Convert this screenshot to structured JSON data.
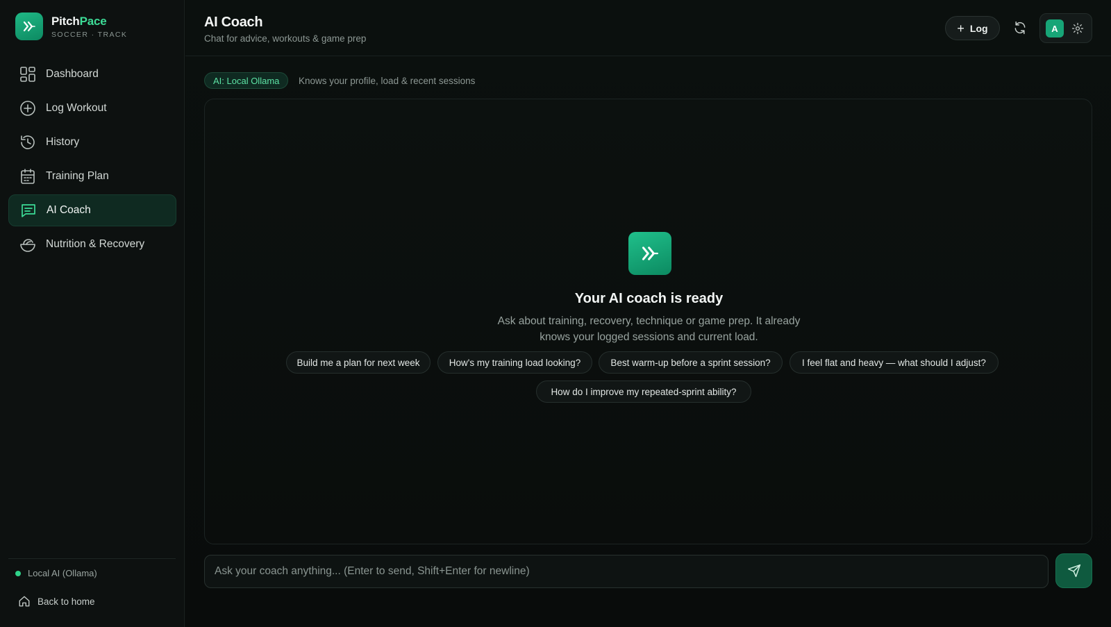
{
  "brand": {
    "name_part1": "Pitch",
    "name_part2": "Pace",
    "subtitle": "SOCCER · TRACK"
  },
  "sidebar": {
    "items": [
      {
        "label": "Dashboard",
        "icon": "dashboard-grid-icon"
      },
      {
        "label": "Log Workout",
        "icon": "plus-circle-icon"
      },
      {
        "label": "History",
        "icon": "history-clock-icon"
      },
      {
        "label": "Training Plan",
        "icon": "calendar-icon"
      },
      {
        "label": "AI Coach",
        "icon": "chat-icon",
        "active": true
      },
      {
        "label": "Nutrition & Recovery",
        "icon": "salad-bowl-icon"
      }
    ],
    "status_label": "Local AI (Ollama)",
    "back_label": "Back to home"
  },
  "header": {
    "title": "AI Coach",
    "subtitle": "Chat for advice, workouts & game prep",
    "log_label": "Log",
    "avatar_letter": "A"
  },
  "ai": {
    "badge": "AI: Local Ollama",
    "description": "Knows your profile, load & recent sessions"
  },
  "chat": {
    "ready_title": "Your AI coach is ready",
    "ready_desc": "Ask about training, recovery, technique or game prep. It already knows your logged sessions and current load.",
    "suggestions": [
      "Build me a plan for next week",
      "How's my training load looking?",
      "Best warm-up before a sprint session?",
      "I feel flat and heavy — what should I adjust?",
      "How do I improve my repeated-sprint ability?"
    ]
  },
  "composer": {
    "placeholder": "Ask your coach anything...  (Enter to send, Shift+Enter for newline)"
  },
  "colors": {
    "accent": "#3ddc97",
    "brand_green": "#17a577",
    "background": "#0a0d0c"
  }
}
